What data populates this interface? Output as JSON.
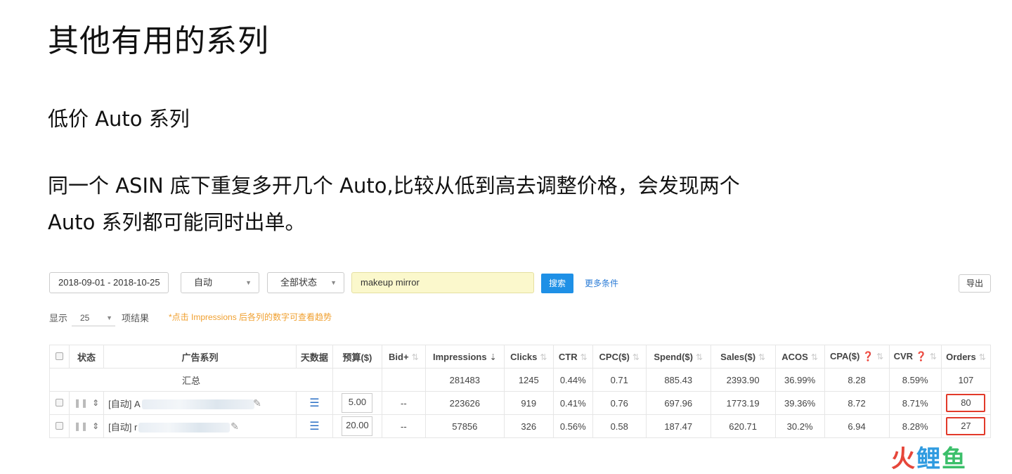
{
  "doc": {
    "title": "其他有用的系列",
    "subhead": "低价 Auto 系列",
    "para_line1": "同一个 ASIN 底下重复多开几个 Auto,比较从低到高去调整价格，会发现两个",
    "para_line2": "Auto 系列都可能同时出单。"
  },
  "toolbar": {
    "date_range": "2018-09-01 - 2018-10-25",
    "type_select": "自动",
    "status_select": "全部状态",
    "search_value": "makeup mirror",
    "search_button": "搜索",
    "more_conditions": "更多条件",
    "export_button": "导出"
  },
  "pager": {
    "show_label": "显示",
    "page_size": "25",
    "results_label": "项结果",
    "hint": "*点击 Impressions 后各列的数字可查看趋势"
  },
  "table": {
    "headers": {
      "status": "状态",
      "campaign": "广告系列",
      "daily": "天数据",
      "budget": "预算($)",
      "bid": "Bid+",
      "impressions": "Impressions",
      "clicks": "Clicks",
      "ctr": "CTR",
      "cpc": "CPC($)",
      "spend": "Spend($)",
      "sales": "Sales($)",
      "acos": "ACOS",
      "cpa": "CPA($)",
      "cvr": "CVR",
      "orders": "Orders"
    },
    "summary": {
      "label": "汇总",
      "impressions": "281483",
      "clicks": "1245",
      "ctr": "0.44%",
      "cpc": "0.71",
      "spend": "885.43",
      "sales": "2393.90",
      "acos": "36.99%",
      "cpa": "8.28",
      "cvr": "8.59%",
      "orders": "107"
    },
    "rows": [
      {
        "name_prefix": "[自动] A",
        "budget": "5.00",
        "bid": "--",
        "impressions": "223626",
        "clicks": "919",
        "ctr": "0.41%",
        "cpc": "0.76",
        "spend": "697.96",
        "sales": "1773.19",
        "acos": "39.36%",
        "cpa": "8.72",
        "cvr": "8.71%",
        "orders": "80"
      },
      {
        "name_prefix": "[自动] r",
        "budget": "20.00",
        "bid": "--",
        "impressions": "57856",
        "clicks": "326",
        "ctr": "0.56%",
        "cpc": "0.58",
        "spend": "187.47",
        "sales": "620.71",
        "acos": "30.2%",
        "cpa": "6.94",
        "cvr": "8.28%",
        "orders": "27"
      }
    ]
  },
  "watermark": {
    "part1": "火",
    "part2": "鲤",
    "part3": "鱼"
  },
  "colors": {
    "accent": "#1e90e6",
    "highlight": "#e23a2a",
    "hint": "#f0a030"
  }
}
